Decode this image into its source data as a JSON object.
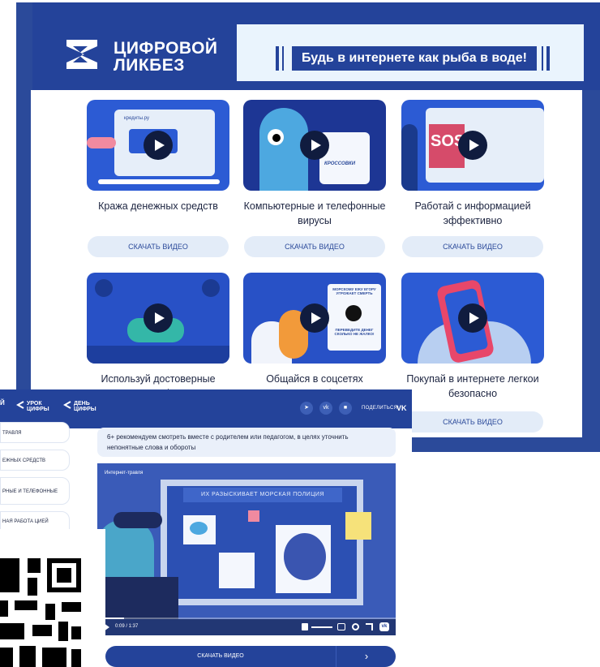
{
  "brand": {
    "logo_line1": "ЦИФРОВОЙ",
    "logo_line2": "ЛИКБЕЗ",
    "slogan": "Будь в интернете как рыба в воде!"
  },
  "colors": {
    "primary": "#24439a",
    "light": "#eaf4fd",
    "button": "#e3ecf8",
    "text": "#1c2440"
  },
  "cards": [
    {
      "title": "Кража денежных средств",
      "thumb_text": "кредиты.ру",
      "button": "СКАЧАТЬ ВИДЕО"
    },
    {
      "title": "Компьютерные и телефонные вирусы",
      "thumb_text": "КРОССОВКИ",
      "button": "СКАЧАТЬ ВИДЕО"
    },
    {
      "title": "Работай с информацией эффективно",
      "thumb_text": "SOS",
      "button": "СКАЧАТЬ ВИДЕО"
    },
    {
      "title": "Используй достоверные источники информации",
      "button": ""
    },
    {
      "title": "Общайся в соцсетях мессенджерах безопасно",
      "thumb_text": "МОРСКОМУ ЕЖУ ЕГОРУ УГРОЖАЕТ СМЕРТЬ",
      "thumb_text2": "ПЕРЕВЕДИТЕ ДЕНЕГ СКОЛЬКО НЕ ЖАЛКО!",
      "button": ""
    },
    {
      "title": "Покупай в интернете легкои безопасно",
      "button": "СКАЧАТЬ ВИДЕО"
    }
  ],
  "front": {
    "logo_partial": "Й",
    "nav": [
      {
        "label1": "УРОК",
        "label2": "ЦИФРЫ"
      },
      {
        "label1": "ДЕНЬ",
        "label2": "ЦИФРЫ"
      }
    ],
    "share_label": "ПОДЕЛИТЬСЯ:",
    "vk_label": "VK",
    "sidebar": [
      "ТРАВЛЯ",
      "ЕЖНЫХ СРЕДСТВ",
      "РНЫЕ И ТЕЛЕФОННЫЕ",
      "НАЯ РАБОТА ЦИЕЙ"
    ],
    "notice": "6+ рекомендуем смотреть вместе с родителем или педагогом, в целях уточнить непонятные слова и обороты",
    "video": {
      "label": "Интернет-травля",
      "banner": "ИХ РАЗЫСКИВАЕТ МОРСКАЯ ПОЛИЦИЯ",
      "time": "0:09 / 1:37",
      "progress": 0.09
    },
    "download": "СКАЧАТЬ ВИДЕО",
    "download_arrow": "›"
  }
}
